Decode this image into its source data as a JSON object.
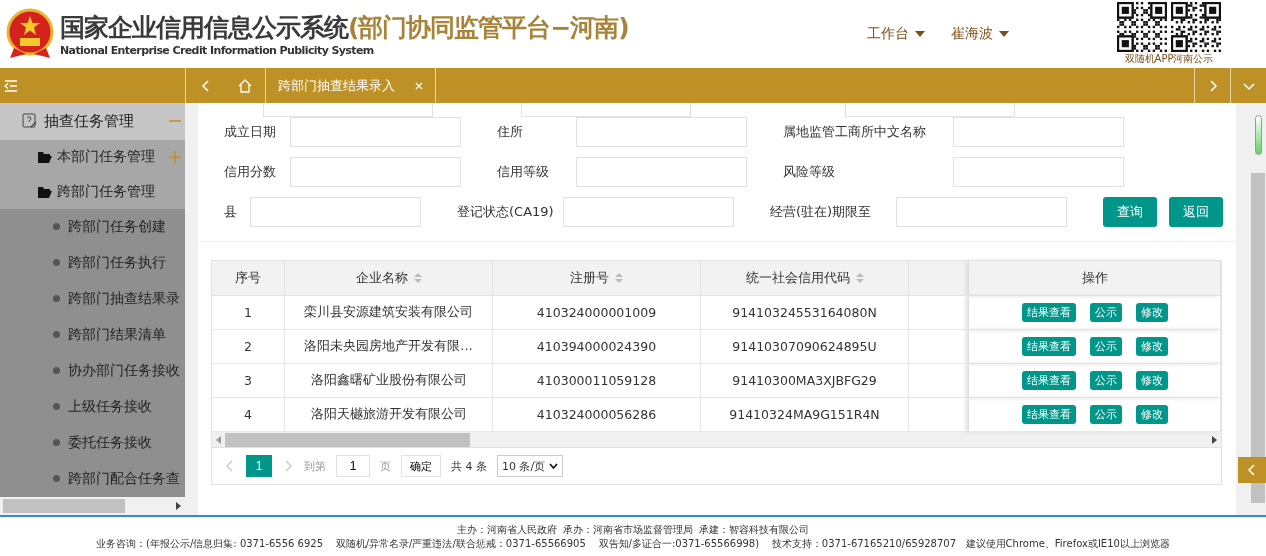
{
  "header": {
    "title": "国家企业信用信息公示系统",
    "title_suffix": "(部门协同监管平台−河南)",
    "subtitle": "National Enterprise Credit Information Publicity System",
    "nav": [
      {
        "label": "工作台"
      },
      {
        "label": "崔海波"
      }
    ],
    "qr_caption": "双随机APP河南公示"
  },
  "tabbar": {
    "tabs": [
      {
        "label": "跨部门抽查结果录入",
        "selected": true
      }
    ]
  },
  "sidebar": {
    "items": [
      {
        "label": "抽查任务管理",
        "expanded": true,
        "children": [
          {
            "label": "本部门任务管理",
            "expanded": false
          },
          {
            "label": "跨部门任务管理",
            "expanded": true,
            "children": [
              {
                "label": "跨部门任务创建"
              },
              {
                "label": "跨部门任务执行"
              },
              {
                "label": "跨部门抽查结果录"
              },
              {
                "label": "跨部门结果清单"
              },
              {
                "label": "协办部门任务接收"
              },
              {
                "label": "上级任务接收"
              },
              {
                "label": "委托任务接收"
              },
              {
                "label": "跨部门配合任务查"
              }
            ]
          }
        ]
      }
    ]
  },
  "form": {
    "rows": [
      [
        {
          "label": "成立日期"
        },
        {
          "label": "住所"
        },
        {
          "label": "属地监管工商所中文名称"
        }
      ],
      [
        {
          "label": "信用分数"
        },
        {
          "label": "信用等级"
        },
        {
          "label": "风险等级"
        }
      ],
      [
        {
          "label": "县"
        },
        {
          "label": "登记状态(CA19)"
        },
        {
          "label": "经营(驻在)期限至"
        }
      ]
    ],
    "buttons": [
      "查询",
      "返回"
    ]
  },
  "table": {
    "columns": [
      {
        "label": "序号",
        "sortable": false
      },
      {
        "label": "企业名称",
        "sortable": true
      },
      {
        "label": "注册号",
        "sortable": true
      },
      {
        "label": "统一社会信用代码",
        "sortable": true
      },
      {
        "sortable": false
      },
      {
        "label": "操作",
        "sortable": false
      }
    ],
    "rows": [
      {
        "no": "1",
        "name": "栾川县安源建筑安装有限公司",
        "reg": "410324000001009",
        "code": "91410324553164080N",
        "actions": [
          "结果查看",
          "公示",
          "修改"
        ]
      },
      {
        "no": "2",
        "name": "洛阳未央园房地产开发有限…",
        "reg": "410394000024390",
        "code": "91410307090624895U",
        "actions": [
          "结果查看",
          "公示",
          "修改"
        ]
      },
      {
        "no": "3",
        "name": "洛阳鑫曙矿业股份有限公司",
        "reg": "410300011059128",
        "code": "91410300MA3XJBFG29",
        "actions": [
          "结果查看",
          "公示",
          "修改"
        ]
      },
      {
        "no": "4",
        "name": "洛阳天樾旅游开发有限公司",
        "reg": "410324000056286",
        "code": "91410324MA9G151R4N",
        "actions": [
          "结果查看",
          "公示",
          "修改"
        ]
      }
    ]
  },
  "pagination": {
    "pages": [
      {
        "label": "1",
        "selected": true
      }
    ],
    "goto_label": "到第",
    "page_value": "1",
    "page_unit": "页",
    "confirm": "确定",
    "total": "共 4 条",
    "page_size": "10 条/页"
  },
  "footer": {
    "lines": [
      "主办：河南省人民政府  承办：河南省市场监督管理局  承建：智容科技有限公司",
      "业务咨询：(年报公示/信息归集: 0371-6556 6925    双随机/异常名录/严重违法/联合惩戒：0371-65566905    双告知/多证合一:0371-65566998)    技术支持：0371-67165210/65928707   建议使用Chrome、Firefox或IE10以上浏览器"
    ]
  }
}
